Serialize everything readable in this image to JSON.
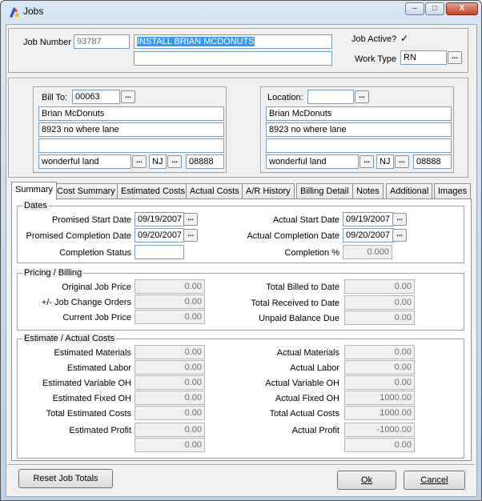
{
  "window": {
    "title": "Jobs",
    "controls": {
      "minimize": "–",
      "maximize": "□",
      "close": "X"
    }
  },
  "job": {
    "number_label": "Job Number",
    "number": "93787",
    "description": "INSTALL BRIAN MCDONUTS",
    "description2": "",
    "active_label": "Job Active?",
    "active_check": "✓",
    "work_type_label": "Work Type",
    "work_type": "RN"
  },
  "bill_to": {
    "label": "Bill To:",
    "code": "00063",
    "name": "Brian McDonuts",
    "address1": "8923 no where lane",
    "address2": "",
    "city": "wonderful land",
    "state": "NJ",
    "zip": "08888"
  },
  "location": {
    "label": "Location:",
    "code": "",
    "name": "Brian McDonuts",
    "address1": "8923 no where lane",
    "address2": "",
    "city": "wonderful land",
    "state": "NJ",
    "zip": "08888"
  },
  "ellipsis": "...",
  "tabs": [
    "Summary",
    "Cost Summary",
    "Estimated Costs",
    "Actual Costs",
    "A/R History",
    "Billing Detail",
    "Notes",
    "Additional",
    "Images"
  ],
  "dates": {
    "title": "Dates",
    "promised_start_label": "Promised Start Date",
    "promised_start": "09/19/2007",
    "promised_completion_label": "Promised Completion Date",
    "promised_completion": "09/20/2007",
    "completion_status_label": "Completion Status",
    "completion_status": "",
    "actual_start_label": "Actual Start Date",
    "actual_start": "09/19/2007",
    "actual_completion_label": "Actual Completion Date",
    "actual_completion": "09/20/2007",
    "completion_pct_label": "Completion %",
    "completion_pct": "0.000"
  },
  "pricing": {
    "title": "Pricing / Billing",
    "original_label": "Original Job Price",
    "original": "0.00",
    "change_orders_label": "+/- Job Change Orders",
    "change_orders": "0.00",
    "current_label": "Current Job Price",
    "current": "0.00",
    "billed_label": "Total Billed to Date",
    "billed": "0.00",
    "received_label": "Total Received to Date",
    "received": "0.00",
    "unpaid_label": "Unpaid Balance Due",
    "unpaid": "0.00"
  },
  "costs": {
    "title": "Estimate / Actual Costs",
    "est_materials_label": "Estimated Materials",
    "est_materials": "0.00",
    "est_labor_label": "Estimated Labor",
    "est_labor": "0.00",
    "est_var_oh_label": "Estimated Variable OH",
    "est_var_oh": "0.00",
    "est_fixed_oh_label": "Estimated Fixed OH",
    "est_fixed_oh": "0.00",
    "total_est_label": "Total Estimated Costs",
    "total_est": "0.00",
    "est_profit_label": "Estimated Profit",
    "est_profit": "0.00",
    "est_profit_pct": "0.00",
    "act_materials_label": "Actual Materials",
    "act_materials": "0.00",
    "act_labor_label": "Actual Labor",
    "act_labor": "0.00",
    "act_var_oh_label": "Actual Variable OH",
    "act_var_oh": "0.00",
    "act_fixed_oh_label": "Actual Fixed OH",
    "act_fixed_oh": "1000.00",
    "total_act_label": "Total Actual Costs",
    "total_act": "1000.00",
    "act_profit_label": "Actual Profit",
    "act_profit": "-1000.00",
    "act_profit_pct": "0.00"
  },
  "buttons": {
    "reset": "Reset Job Totals",
    "ok": "Ok",
    "cancel": "Cancel"
  }
}
